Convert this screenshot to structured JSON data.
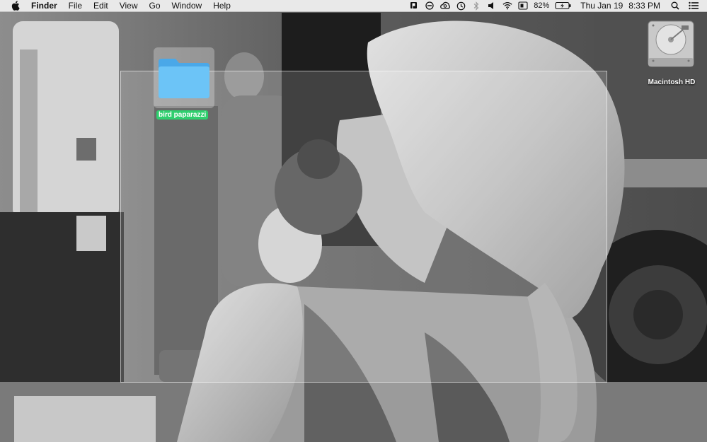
{
  "menubar": {
    "app_name": "Finder",
    "menus": [
      "File",
      "Edit",
      "View",
      "Go",
      "Window",
      "Help"
    ],
    "battery_percent": "82%",
    "date": "Thu Jan 19",
    "time": "8:33 PM"
  },
  "desktop": {
    "folder_name": "bird paparazzi",
    "drive_name": "Macintosh HD",
    "folder_label_color": "#2fcf6e",
    "folder_color": "#5ab6f0"
  }
}
